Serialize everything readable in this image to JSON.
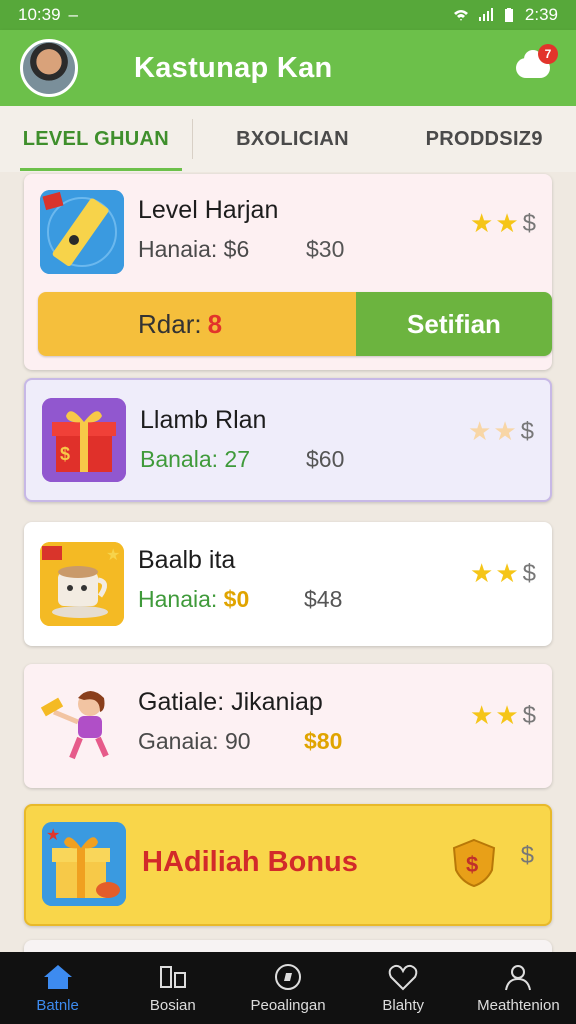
{
  "status_bar": {
    "time_left": "10:39",
    "time_right": "2:39"
  },
  "header": {
    "title": "Kastunap Kan",
    "notification_count": "7"
  },
  "tabs": [
    {
      "label": "LEVEL GHUAN"
    },
    {
      "label": "BXOLICIAN"
    },
    {
      "label": "PRODDSIZ9"
    }
  ],
  "cards": [
    {
      "title": "Level Harjan",
      "sub1": "Hanaia: $6",
      "sub2": "$30",
      "stars": 2,
      "icon": "level-tool-icon"
    },
    {
      "title": "Llamb Rlan",
      "sub1": "Banala: 27",
      "sub2": "$60",
      "stars": 2,
      "icon": "gift-box-icon"
    },
    {
      "title": "Baalb ita",
      "sub1_label": "Hanaia:",
      "sub1_value": "$0",
      "sub2": "$48",
      "stars": 2,
      "icon": "coffee-cup-icon"
    },
    {
      "title": "Gatiale: Jikaniap",
      "sub1": "Ganaia: 90",
      "sub2": "$80",
      "stars": 2,
      "icon": "running-girl-icon"
    }
  ],
  "reward": {
    "label": "Rdar:",
    "value": "8",
    "button": "Setifian"
  },
  "bonus": {
    "title": "HAdiliah Bonus"
  },
  "nav": [
    {
      "label": "Batnle",
      "icon": "home-icon"
    },
    {
      "label": "Bosian",
      "icon": "store-icon"
    },
    {
      "label": "Peoalingan",
      "icon": "compass-icon"
    },
    {
      "label": "Blahty",
      "icon": "heart-icon"
    },
    {
      "label": "Meathtenion",
      "icon": "profile-icon"
    }
  ],
  "colors": {
    "header": "#6cc04a",
    "status": "#57a83a",
    "accent_green": "#6cb43f",
    "gold": "#f5bf3c",
    "nav_active": "#3d8bf0"
  }
}
